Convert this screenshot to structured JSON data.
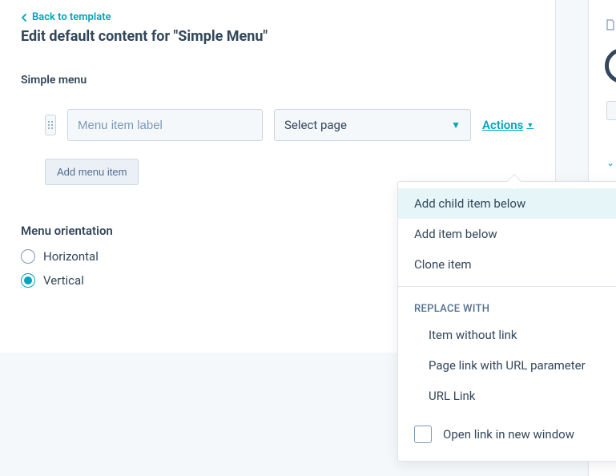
{
  "back_link": "Back to template",
  "page_title": "Edit default content for \"Simple Menu\"",
  "simple_menu": {
    "section_label": "Simple menu",
    "item": {
      "label_placeholder": "Menu item label",
      "label_value": "",
      "page_select_value": "Select page"
    },
    "add_button": "Add menu item"
  },
  "actions": {
    "trigger": "Actions",
    "add_child": "Add child item below",
    "add_below": "Add item below",
    "clone": "Clone item",
    "replace_label": "REPLACE WITH",
    "replace_options": {
      "no_link": "Item without link",
      "page_url": "Page link with URL parameter",
      "url_link": "URL Link"
    },
    "open_new_window": "Open link in new window"
  },
  "orientation": {
    "label": "Menu orientation",
    "horizontal": "Horizontal",
    "vertical": "Vertical",
    "selected": "vertical"
  }
}
